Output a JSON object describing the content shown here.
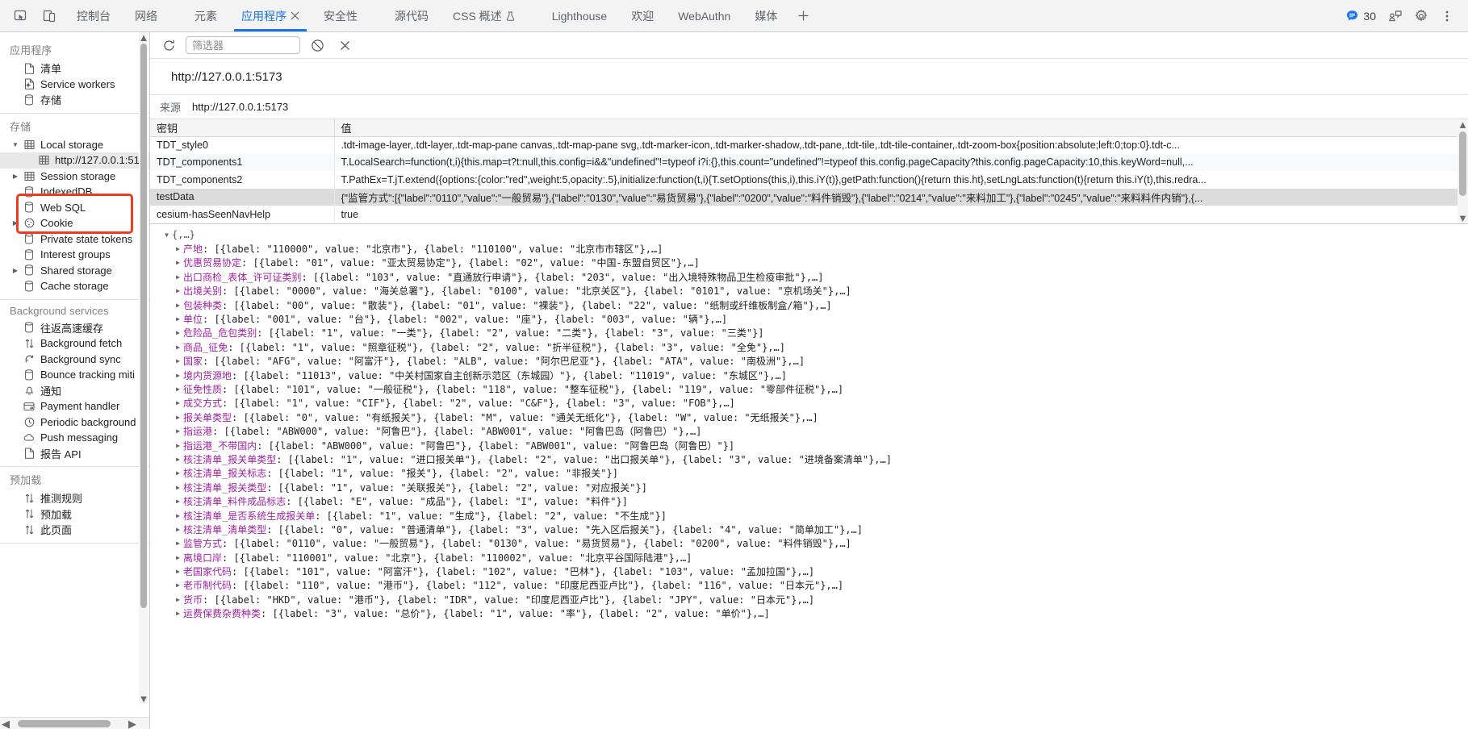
{
  "tabbar": {
    "dock_icons": [
      "inspect-element-icon",
      "device-toolbar-icon"
    ],
    "tabs": [
      {
        "label": "控制台",
        "active": false,
        "icon": null
      },
      {
        "label": "网络",
        "active": false,
        "icon": null
      },
      {
        "label": "元素",
        "active": false,
        "icon": null
      },
      {
        "label": "应用程序",
        "active": true,
        "icon": "close-x-icon"
      },
      {
        "label": "安全性",
        "active": false,
        "icon": null
      },
      {
        "label": "源代码",
        "active": false,
        "icon": null
      },
      {
        "label": "CSS 概述",
        "active": false,
        "icon": "beaker-icon"
      },
      {
        "label": "Lighthouse",
        "active": false,
        "icon": null
      },
      {
        "label": "欢迎",
        "active": false,
        "icon": null
      },
      {
        "label": "WebAuthn",
        "active": false,
        "icon": null
      },
      {
        "label": "媒体",
        "active": false,
        "icon": null
      }
    ],
    "add_tab_label": "+",
    "message_count": "30",
    "right_icons": [
      "console-message-icon",
      "devtools-settings-icon",
      "more-options-icon"
    ],
    "accent_color": "#1a73e8"
  },
  "sidebar": {
    "sections": [
      {
        "title": "应用程序",
        "items": [
          {
            "label": "清单",
            "icon": "manifest-file-icon",
            "indent": 2,
            "twisty": "",
            "selected": false
          },
          {
            "label": "Service workers",
            "icon": "service-worker-icon",
            "indent": 2,
            "twisty": "",
            "selected": false
          },
          {
            "label": "存储",
            "icon": "database-icon",
            "indent": 2,
            "twisty": "",
            "selected": false
          }
        ]
      },
      {
        "title": "存储",
        "items": [
          {
            "label": "Local storage",
            "icon": "table-grid-icon",
            "indent": 2,
            "twisty": "▼",
            "selected": false
          },
          {
            "label": "http://127.0.0.1:51",
            "icon": "table-grid-icon",
            "indent": 3,
            "twisty": "",
            "selected": true
          },
          {
            "label": "Session storage",
            "icon": "table-grid-icon",
            "indent": 2,
            "twisty": "▶",
            "selected": false
          },
          {
            "label": "IndexedDB",
            "icon": "database-icon",
            "indent": 2,
            "twisty": "",
            "selected": false
          },
          {
            "label": "Web SQL",
            "icon": "database-icon",
            "indent": 2,
            "twisty": "",
            "selected": false
          },
          {
            "label": "Cookie",
            "icon": "cookie-icon",
            "indent": 2,
            "twisty": "▶",
            "selected": false
          },
          {
            "label": "Private state tokens",
            "icon": "database-icon",
            "indent": 2,
            "twisty": "",
            "selected": false
          },
          {
            "label": "Interest groups",
            "icon": "database-icon",
            "indent": 2,
            "twisty": "",
            "selected": false
          },
          {
            "label": "Shared storage",
            "icon": "database-icon",
            "indent": 2,
            "twisty": "▶",
            "selected": false
          },
          {
            "label": "Cache storage",
            "icon": "database-icon",
            "indent": 2,
            "twisty": "",
            "selected": false
          }
        ]
      },
      {
        "title": "Background services",
        "items": [
          {
            "label": "往返高速缓存",
            "icon": "database-icon",
            "indent": 2,
            "twisty": "",
            "selected": false
          },
          {
            "label": "Background fetch",
            "icon": "arrows-updown-icon",
            "indent": 2,
            "twisty": "",
            "selected": false
          },
          {
            "label": "Background sync",
            "icon": "sync-circle-icon",
            "indent": 2,
            "twisty": "",
            "selected": false
          },
          {
            "label": "Bounce tracking miti",
            "icon": "database-icon",
            "indent": 2,
            "twisty": "",
            "selected": false
          },
          {
            "label": "通知",
            "icon": "bell-icon",
            "indent": 2,
            "twisty": "",
            "selected": false
          },
          {
            "label": "Payment handler",
            "icon": "credit-card-icon",
            "indent": 2,
            "twisty": "",
            "selected": false
          },
          {
            "label": "Periodic background",
            "icon": "clock-icon",
            "indent": 2,
            "twisty": "",
            "selected": false
          },
          {
            "label": "Push messaging",
            "icon": "cloud-icon",
            "indent": 2,
            "twisty": "",
            "selected": false
          },
          {
            "label": "报告 API",
            "icon": "report-file-icon",
            "indent": 2,
            "twisty": "",
            "selected": false
          }
        ]
      },
      {
        "title": "预加载",
        "items": [
          {
            "label": "推测规则",
            "icon": "arrows-updown-icon",
            "indent": 2,
            "twisty": "",
            "selected": false
          },
          {
            "label": "预加载",
            "icon": "arrows-updown-icon",
            "indent": 2,
            "twisty": "",
            "selected": false
          },
          {
            "label": "此页面",
            "icon": "arrows-updown-icon",
            "indent": 2,
            "twisty": "",
            "selected": false
          }
        ]
      }
    ],
    "annotation_color": "#f03c1e"
  },
  "toolbar": {
    "refresh_icon": "refresh-icon",
    "filter_placeholder": "筛选器",
    "filter_value": "",
    "clear_icon": "clear-all-icon",
    "delete_icon": "delete-selected-icon"
  },
  "panel": {
    "url_title": "http://127.0.0.1:5173",
    "origin_label": "来源",
    "origin_value": "http://127.0.0.1:5173"
  },
  "table": {
    "columns": [
      "密钥",
      "值"
    ],
    "rows": [
      {
        "key": "TDT_style0",
        "value": ".tdt-image-layer,.tdt-layer,.tdt-map-pane canvas,.tdt-map-pane svg,.tdt-marker-icon,.tdt-marker-shadow,.tdt-pane,.tdt-tile,.tdt-tile-container,.tdt-zoom-box{position:absolute;left:0;top:0}.tdt-c...",
        "selected": false
      },
      {
        "key": "TDT_components1",
        "value": "T.LocalSearch=function(t,i){this.map=t?t:null,this.config=i&&\"undefined\"!=typeof i?i:{},this.count=\"undefined\"!=typeof this.config.pageCapacity?this.config.pageCapacity:10,this.keyWord=null,...",
        "selected": false
      },
      {
        "key": "TDT_components2",
        "value": "T.PathEx=T.jT.extend({options:{color:\"red\",weight:5,opacity:.5},initialize:function(t,i){T.setOptions(this,i),this.iY(t)},getPath:function(){return this.ht},setLngLats:function(t){return this.iY(t),this.redra...",
        "selected": false
      },
      {
        "key": "testData",
        "value": "{\"监管方式\":[{\"label\":\"0110\",\"value\":\"一般贸易\"},{\"label\":\"0130\",\"value\":\"易货贸易\"},{\"label\":\"0200\",\"value\":\"料件销毁\"},{\"label\":\"0214\",\"value\":\"来料加工\"},{\"label\":\"0245\",\"value\":\"来料料件内销\"},{...",
        "selected": true
      },
      {
        "key": "cesium-hasSeenNavHelp",
        "value": "true",
        "selected": false
      }
    ]
  },
  "preview_tree": {
    "root": "{,…}",
    "root_twisty": "▼",
    "rows": [
      {
        "twisty": "▶",
        "key": "产地",
        "value": ": [{label: \"110000\", value: \"北京市\"}, {label: \"110100\", value: \"北京市市辖区\"},…]"
      },
      {
        "twisty": "▶",
        "key": "优惠贸易协定",
        "value": ": [{label: \"01\", value: \"亚太贸易协定\"}, {label: \"02\", value: \"中国-东盟自贸区\"},…]"
      },
      {
        "twisty": "▶",
        "key": "出口商检_表体_许可证类别",
        "value": ": [{label: \"103\", value: \"直通放行申请\"}, {label: \"203\", value: \"出入境特殊物品卫生检疫审批\"},…]"
      },
      {
        "twisty": "▶",
        "key": "出境关别",
        "value": ": [{label: \"0000\", value: \"海关总署\"}, {label: \"0100\", value: \"北京关区\"}, {label: \"0101\", value: \"京机场关\"},…]"
      },
      {
        "twisty": "▶",
        "key": "包装种类",
        "value": ": [{label: \"00\", value: \"散装\"}, {label: \"01\", value: \"裸装\"}, {label: \"22\", value: \"纸制或纤维板制盒/箱\"},…]"
      },
      {
        "twisty": "▶",
        "key": "单位",
        "value": ": [{label: \"001\", value: \"台\"}, {label: \"002\", value: \"座\"}, {label: \"003\", value: \"辆\"},…]"
      },
      {
        "twisty": "▶",
        "key": "危险品_危包类别",
        "value": ": [{label: \"1\", value: \"一类\"}, {label: \"2\", value: \"二类\"}, {label: \"3\", value: \"三类\"}]"
      },
      {
        "twisty": "▶",
        "key": "商品_征免",
        "value": ": [{label: \"1\", value: \"照章征税\"}, {label: \"2\", value: \"折半征税\"}, {label: \"3\", value: \"全免\"},…]"
      },
      {
        "twisty": "▶",
        "key": "国家",
        "value": ": [{label: \"AFG\", value: \"阿富汗\"}, {label: \"ALB\", value: \"阿尔巴尼亚\"}, {label: \"ATA\", value: \"南极洲\"},…]"
      },
      {
        "twisty": "▶",
        "key": "境内货源地",
        "value": ": [{label: \"11013\", value: \"中关村国家自主创新示范区（东城园）\"}, {label: \"11019\", value: \"东城区\"},…]"
      },
      {
        "twisty": "▶",
        "key": "征免性质",
        "value": ": [{label: \"101\", value: \"一般征税\"}, {label: \"118\", value: \"整车征税\"}, {label: \"119\", value: \"零部件征税\"},…]"
      },
      {
        "twisty": "▶",
        "key": "成交方式",
        "value": ": [{label: \"1\", value: \"CIF\"}, {label: \"2\", value: \"C&F\"}, {label: \"3\", value: \"FOB\"},…]"
      },
      {
        "twisty": "▶",
        "key": "报关单类型",
        "value": ": [{label: \"0\", value: \"有纸报关\"}, {label: \"M\", value: \"通关无纸化\"}, {label: \"W\", value: \"无纸报关\"},…]"
      },
      {
        "twisty": "▶",
        "key": "指运港",
        "value": ": [{label: \"ABW000\", value: \"阿鲁巴\"}, {label: \"ABW001\", value: \"阿鲁巴岛（阿鲁巴）\"},…]"
      },
      {
        "twisty": "▶",
        "key": "指运港_不带国内",
        "value": ": [{label: \"ABW000\", value: \"阿鲁巴\"}, {label: \"ABW001\", value: \"阿鲁巴岛（阿鲁巴）\"}]"
      },
      {
        "twisty": "▶",
        "key": "核注清单_报关单类型",
        "value": ": [{label: \"1\", value: \"进口报关单\"}, {label: \"2\", value: \"出口报关单\"}, {label: \"3\", value: \"进境备案清单\"},…]"
      },
      {
        "twisty": "▶",
        "key": "核注清单_报关标志",
        "value": ": [{label: \"1\", value: \"报关\"}, {label: \"2\", value: \"非报关\"}]"
      },
      {
        "twisty": "▶",
        "key": "核注清单_报关类型",
        "value": ": [{label: \"1\", value: \"关联报关\"}, {label: \"2\", value: \"对应报关\"}]"
      },
      {
        "twisty": "▶",
        "key": "核注清单_料件成品标志",
        "value": ": [{label: \"E\", value: \"成品\"}, {label: \"I\", value: \"料件\"}]"
      },
      {
        "twisty": "▶",
        "key": "核注清单_是否系统生成报关单",
        "value": ": [{label: \"1\", value: \"生成\"}, {label: \"2\", value: \"不生成\"}]"
      },
      {
        "twisty": "▶",
        "key": "核注清单_清单类型",
        "value": ": [{label: \"0\", value: \"普通清单\"}, {label: \"3\", value: \"先入区后报关\"}, {label: \"4\", value: \"简单加工\"},…]"
      },
      {
        "twisty": "▶",
        "key": "监管方式",
        "value": ": [{label: \"0110\", value: \"一般贸易\"}, {label: \"0130\", value: \"易货贸易\"}, {label: \"0200\", value: \"料件销毁\"},…]"
      },
      {
        "twisty": "▶",
        "key": "离境口岸",
        "value": ": [{label: \"110001\", value: \"北京\"}, {label: \"110002\", value: \"北京平谷国际陆港\"},…]"
      },
      {
        "twisty": "▶",
        "key": "老国家代码",
        "value": ": [{label: \"101\", value: \"阿富汗\"}, {label: \"102\", value: \"巴林\"}, {label: \"103\", value: \"孟加拉国\"},…]"
      },
      {
        "twisty": "▶",
        "key": "老币制代码",
        "value": ": [{label: \"110\", value: \"港币\"}, {label: \"112\", value: \"印度尼西亚卢比\"}, {label: \"116\", value: \"日本元\"},…]"
      },
      {
        "twisty": "▶",
        "key": "货币",
        "value": ": [{label: \"HKD\", value: \"港币\"}, {label: \"IDR\", value: \"印度尼西亚卢比\"}, {label: \"JPY\", value: \"日本元\"},…]"
      },
      {
        "twisty": "▶",
        "key": "运费保费杂费种类",
        "value": ": [{label: \"3\", value: \"总价\"}, {label: \"1\", value: \"率\"}, {label: \"2\", value: \"单价\"},…]"
      }
    ]
  }
}
